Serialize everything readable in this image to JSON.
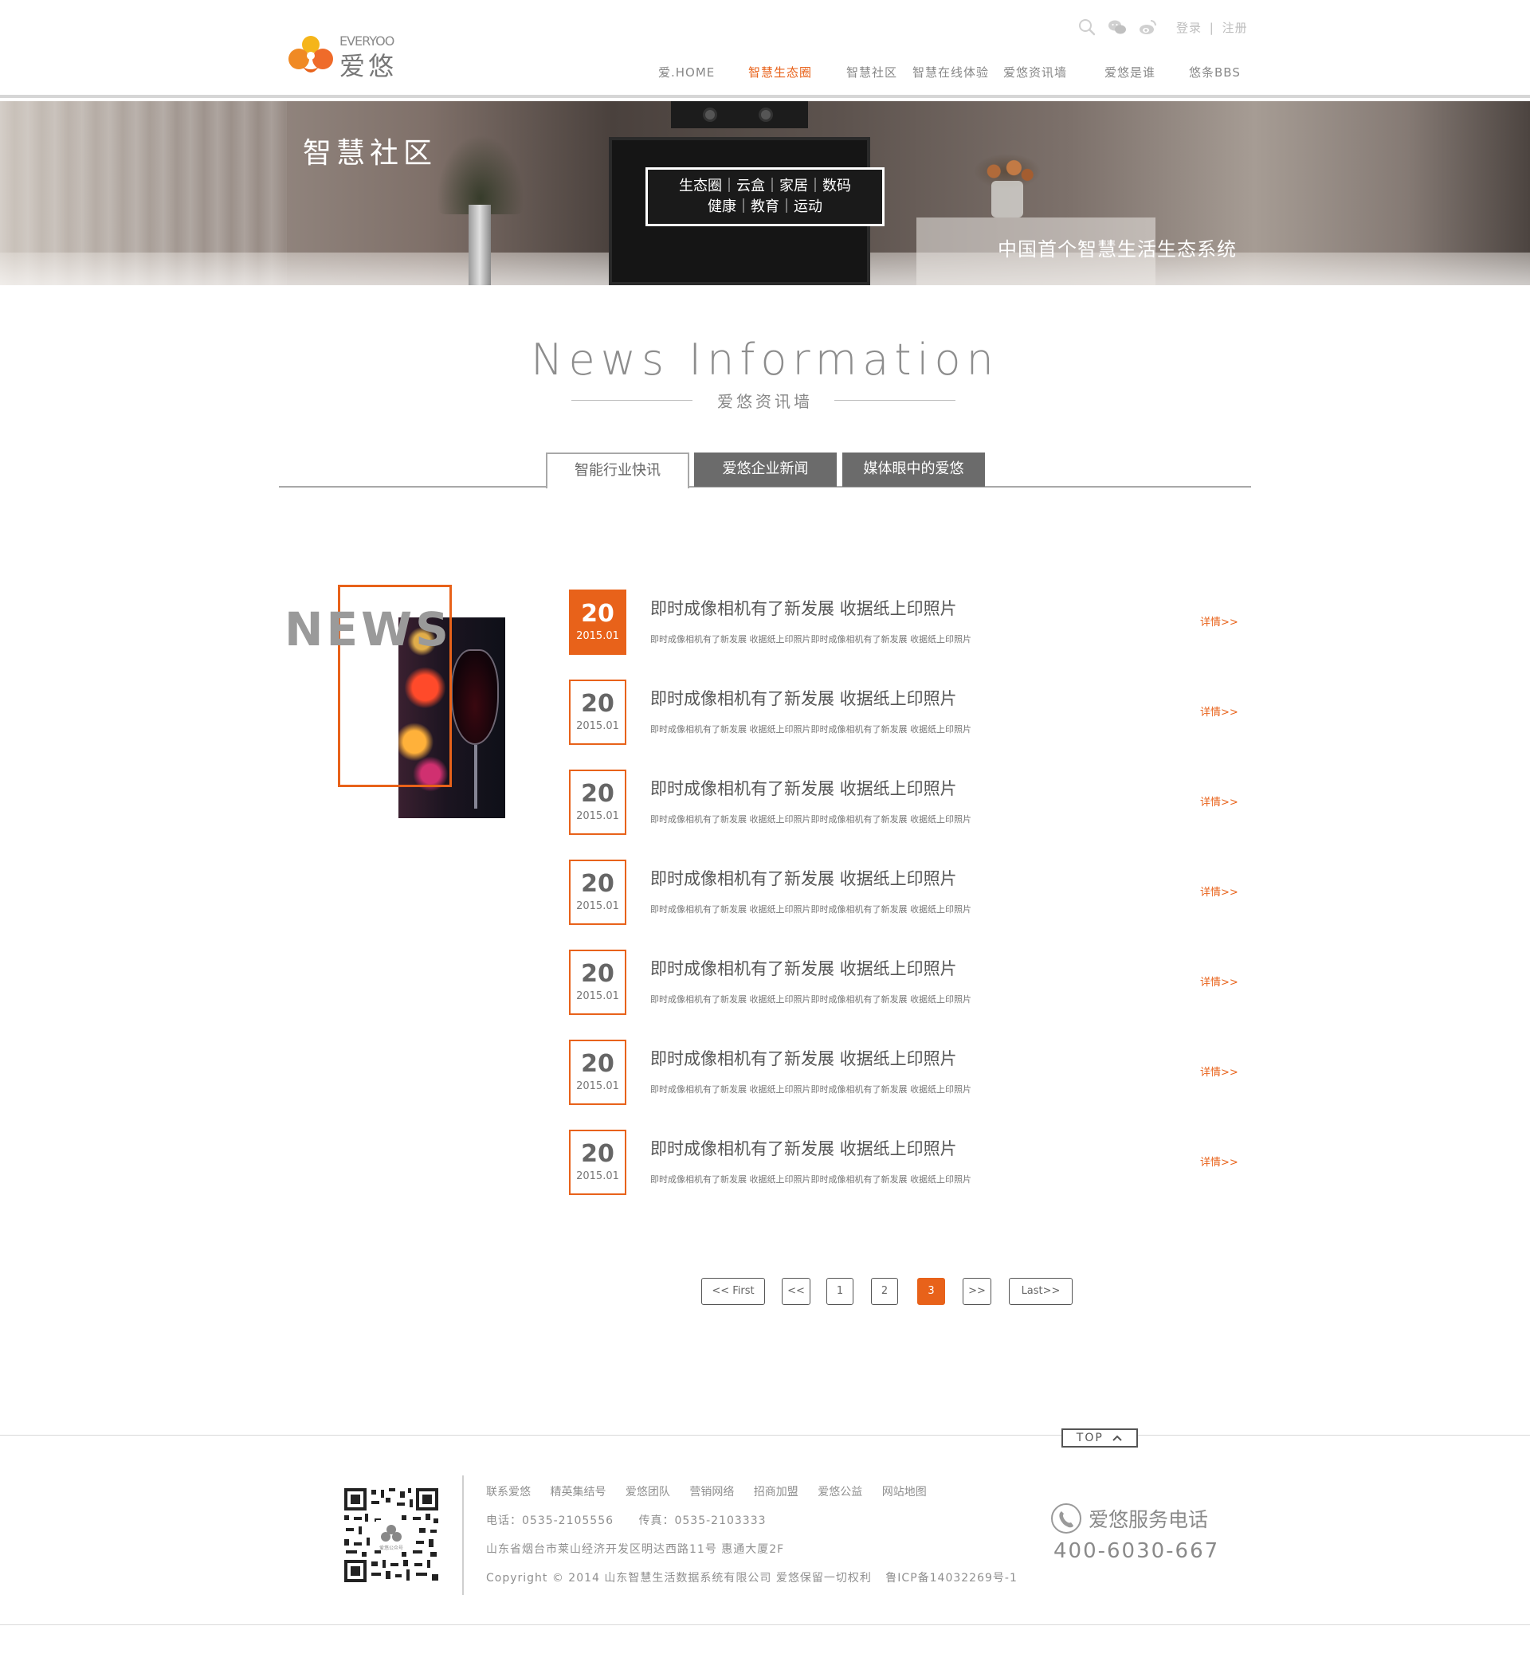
{
  "brand": {
    "name_en": "EVERYOO",
    "name_cn": "爱悠"
  },
  "header": {
    "login": "登录",
    "separator": "|",
    "register": "注册",
    "icons": [
      "search-icon",
      "wechat-icon",
      "weibo-icon"
    ]
  },
  "nav": [
    {
      "label": "爱.HOME",
      "active": false
    },
    {
      "label": "智慧生态圈",
      "active": true
    },
    {
      "label": "智慧社区",
      "active": false
    },
    {
      "label": "智慧在线体验",
      "active": false
    },
    {
      "label": "爱悠资讯墙",
      "active": false
    },
    {
      "label": "爱悠是谁",
      "active": false
    },
    {
      "label": "悠条BBS",
      "active": false
    }
  ],
  "banner": {
    "title": "智慧社区",
    "box_line1": "生态圈｜云盒｜家居｜数码",
    "box_line2": "健康｜教育｜运动",
    "slogan": "中国首个智慧生活生态系统"
  },
  "section": {
    "title": "News Information",
    "subtitle": "爱悠资讯墙"
  },
  "tabs": [
    {
      "label": "智能行业快讯",
      "active": true
    },
    {
      "label": "爱悠企业新闻",
      "active": false
    },
    {
      "label": "媒体眼中的爱悠",
      "active": false
    }
  ],
  "news_side": {
    "label": "NEWS"
  },
  "news": [
    {
      "day": "20",
      "ym": "2015.01",
      "title": "即时成像相机有了新发展 收据纸上印照片",
      "desc": "即时成像相机有了新发展 收据纸上印照片即时成像相机有了新发展 收据纸上印照片",
      "more": "详情>>",
      "active": true
    },
    {
      "day": "20",
      "ym": "2015.01",
      "title": "即时成像相机有了新发展 收据纸上印照片",
      "desc": "即时成像相机有了新发展 收据纸上印照片即时成像相机有了新发展 收据纸上印照片",
      "more": "详情>>",
      "active": false
    },
    {
      "day": "20",
      "ym": "2015.01",
      "title": "即时成像相机有了新发展 收据纸上印照片",
      "desc": "即时成像相机有了新发展 收据纸上印照片即时成像相机有了新发展 收据纸上印照片",
      "more": "详情>>",
      "active": false
    },
    {
      "day": "20",
      "ym": "2015.01",
      "title": "即时成像相机有了新发展 收据纸上印照片",
      "desc": "即时成像相机有了新发展 收据纸上印照片即时成像相机有了新发展 收据纸上印照片",
      "more": "详情>>",
      "active": false
    },
    {
      "day": "20",
      "ym": "2015.01",
      "title": "即时成像相机有了新发展 收据纸上印照片",
      "desc": "即时成像相机有了新发展 收据纸上印照片即时成像相机有了新发展 收据纸上印照片",
      "more": "详情>>",
      "active": false
    },
    {
      "day": "20",
      "ym": "2015.01",
      "title": "即时成像相机有了新发展 收据纸上印照片",
      "desc": "即时成像相机有了新发展 收据纸上印照片即时成像相机有了新发展 收据纸上印照片",
      "more": "详情>>",
      "active": false
    },
    {
      "day": "20",
      "ym": "2015.01",
      "title": "即时成像相机有了新发展 收据纸上印照片",
      "desc": "即时成像相机有了新发展 收据纸上印照片即时成像相机有了新发展 收据纸上印照片",
      "more": "详情>>",
      "active": false
    }
  ],
  "pagination": {
    "first": "<< First",
    "prev": "<<",
    "pages": [
      "1",
      "2",
      "3"
    ],
    "current": "3",
    "next": ">>",
    "last": "Last>>"
  },
  "footer": {
    "top_button": "TOP",
    "qr_caption": "爱悠公众号",
    "links": [
      "联系爱悠",
      "精英集结号",
      "爱悠团队",
      "营销网络",
      "招商加盟",
      "爱悠公益",
      "网站地图"
    ],
    "phone_line": "电话：0535-2105556",
    "fax_line": "传真：0535-2103333",
    "address": "山东省烟台市莱山经济开发区明达西路11号 惠通大厦2F",
    "copyright": "Copyright © 2014 山东智慧生活数据系统有限公司 爱悠保留一切权利",
    "icp": "鲁ICP备14032269号-1",
    "service_label": "爱悠服务电话",
    "service_number": "400-6030-667"
  },
  "colors": {
    "accent": "#e8621a",
    "tab_dark": "#6b6b6b",
    "text": "#666666"
  }
}
